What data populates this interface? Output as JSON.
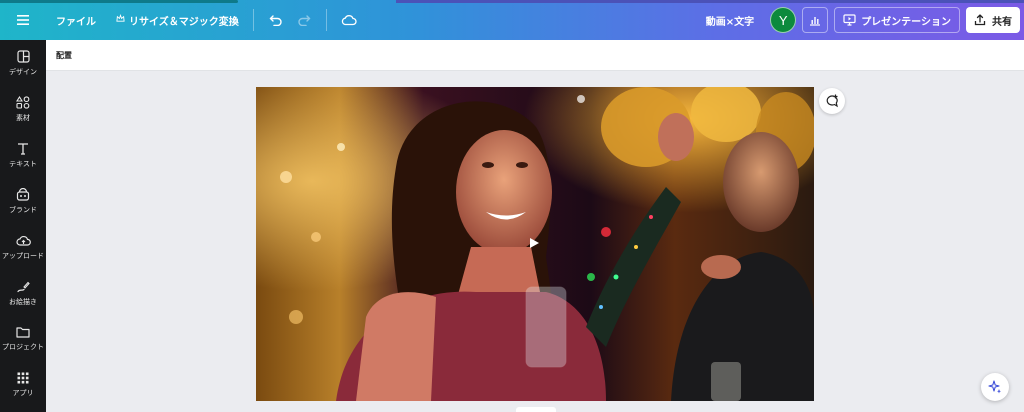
{
  "topbar": {
    "file_label": "ファイル",
    "resize_label": "リサイズ＆マジック変換",
    "doc_title": "動画×文字",
    "avatar_initial": "Y",
    "present_label": "プレゼンテーション",
    "share_label": "共有"
  },
  "sidebar": {
    "items": [
      {
        "label": "デザイン",
        "icon": "layout-icon"
      },
      {
        "label": "素材",
        "icon": "shapes-icon"
      },
      {
        "label": "テキスト",
        "icon": "text-icon"
      },
      {
        "label": "ブランド",
        "icon": "brand-icon"
      },
      {
        "label": "アップロード",
        "icon": "upload-cloud-icon"
      },
      {
        "label": "お絵描き",
        "icon": "draw-icon"
      },
      {
        "label": "プロジェクト",
        "icon": "folder-icon"
      },
      {
        "label": "アプリ",
        "icon": "apps-grid-icon"
      }
    ]
  },
  "subbar": {
    "label": "配置"
  },
  "colors": {
    "sidebar_bg": "#18191b",
    "avatar_bg": "#0c8a3d",
    "canvas_bg": "#ebecf0"
  }
}
